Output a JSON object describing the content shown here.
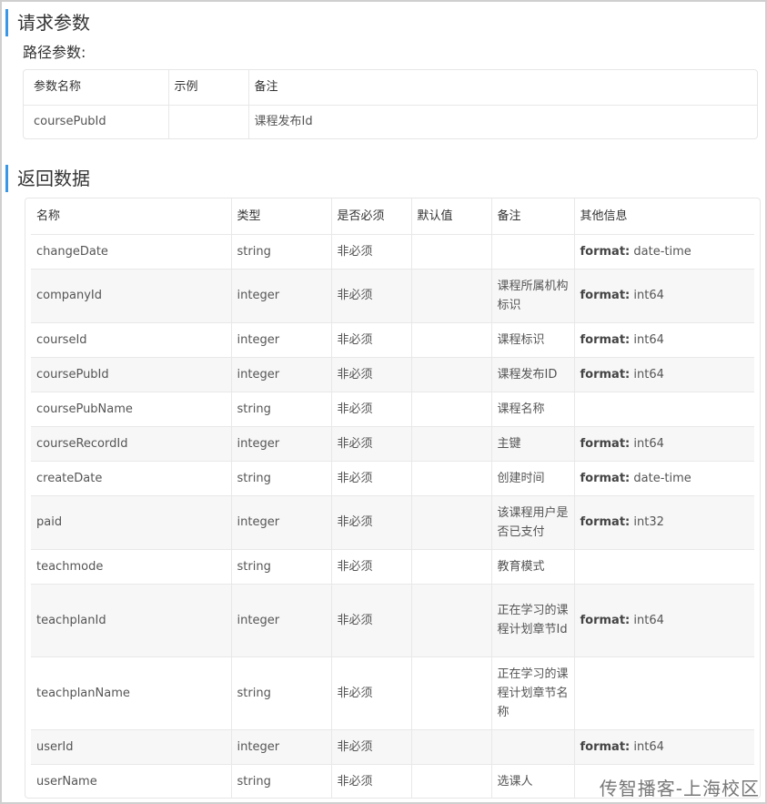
{
  "request_section": {
    "title": "请求参数",
    "path_params_label": "路径参数:",
    "headers": [
      "参数名称",
      "示例",
      "备注"
    ],
    "rows": [
      {
        "name": "coursePubId",
        "example": "",
        "note": "课程发布Id"
      }
    ]
  },
  "response_section": {
    "title": "返回数据",
    "headers": [
      "名称",
      "类型",
      "是否必须",
      "默认值",
      "备注",
      "其他信息"
    ],
    "rows": [
      {
        "name": "changeDate",
        "type": "string",
        "required": "非必须",
        "default": "",
        "note": "",
        "format_key": "format:",
        "format_val": "date-time"
      },
      {
        "name": "companyId",
        "type": "integer",
        "required": "非必须",
        "default": "",
        "note": "课程所属机构标识",
        "format_key": "format:",
        "format_val": "int64"
      },
      {
        "name": "courseId",
        "type": "integer",
        "required": "非必须",
        "default": "",
        "note": "课程标识",
        "format_key": "format:",
        "format_val": "int64"
      },
      {
        "name": "coursePubId",
        "type": "integer",
        "required": "非必须",
        "default": "",
        "note": "课程发布ID",
        "format_key": "format:",
        "format_val": "int64"
      },
      {
        "name": "coursePubName",
        "type": "string",
        "required": "非必须",
        "default": "",
        "note": "课程名称",
        "format_key": "",
        "format_val": ""
      },
      {
        "name": "courseRecordId",
        "type": "integer",
        "required": "非必须",
        "default": "",
        "note": "主键",
        "format_key": "format:",
        "format_val": "int64"
      },
      {
        "name": "createDate",
        "type": "string",
        "required": "非必须",
        "default": "",
        "note": "创建时间",
        "format_key": "format:",
        "format_val": "date-time"
      },
      {
        "name": "paid",
        "type": "integer",
        "required": "非必须",
        "default": "",
        "note": "该课程用户是否已支付",
        "format_key": "format:",
        "format_val": "int32"
      },
      {
        "name": "teachmode",
        "type": "string",
        "required": "非必须",
        "default": "",
        "note": "教育模式",
        "format_key": "",
        "format_val": ""
      },
      {
        "name": "teachplanId",
        "type": "integer",
        "required": "非必须",
        "default": "",
        "note": "正在学习的课程计划章节Id",
        "format_key": "format:",
        "format_val": "int64"
      },
      {
        "name": "teachplanName",
        "type": "string",
        "required": "非必须",
        "default": "",
        "note": "正在学习的课程计划章节名称",
        "format_key": "",
        "format_val": ""
      },
      {
        "name": "userId",
        "type": "integer",
        "required": "非必须",
        "default": "",
        "note": "",
        "format_key": "format:",
        "format_val": "int64"
      },
      {
        "name": "userName",
        "type": "string",
        "required": "非必须",
        "default": "",
        "note": "选课人",
        "format_key": "",
        "format_val": ""
      }
    ]
  },
  "watermark": "传智播客-上海校区",
  "colors": {
    "accent": "#3a97e6",
    "alt_row": "#f7f7f7",
    "border": "#e8e8e8"
  }
}
